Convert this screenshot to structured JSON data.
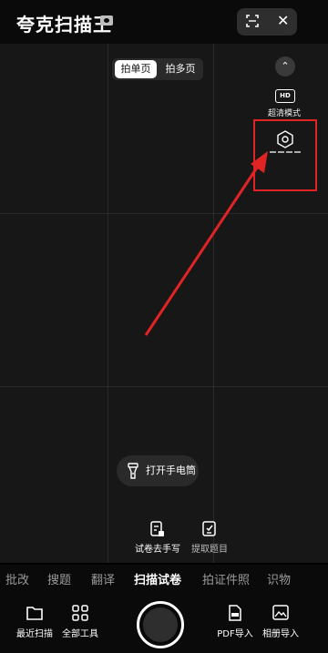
{
  "app": {
    "title": "夸克扫描王"
  },
  "capture_mode": {
    "options": [
      "拍单页",
      "拍多页"
    ],
    "selected": "拍单页"
  },
  "side_panel": {
    "collapse_glyph": "⌃",
    "hd_badge": "HD",
    "hd_label": "超清模式"
  },
  "flashlight": {
    "label": "打开手电筒"
  },
  "sub_tools": [
    {
      "label": "试卷去手写",
      "icon": "paper-erase-icon"
    },
    {
      "label": "提取题目",
      "icon": "extract-question-icon"
    }
  ],
  "mode_tabs": [
    {
      "label": "批改"
    },
    {
      "label": "搜题"
    },
    {
      "label": "翻译"
    },
    {
      "label": "扫描试卷",
      "active": true
    },
    {
      "label": "拍证件照"
    },
    {
      "label": "识物"
    }
  ],
  "bottom_tools": {
    "left": [
      {
        "label": "最近扫描"
      },
      {
        "label": "全部工具"
      }
    ],
    "right": [
      {
        "label": "PDF导入"
      },
      {
        "label": "相册导入"
      }
    ]
  },
  "top_bar": {
    "close_glyph": "✕"
  },
  "colors": {
    "highlight": "#e02424",
    "background": "#171717"
  }
}
